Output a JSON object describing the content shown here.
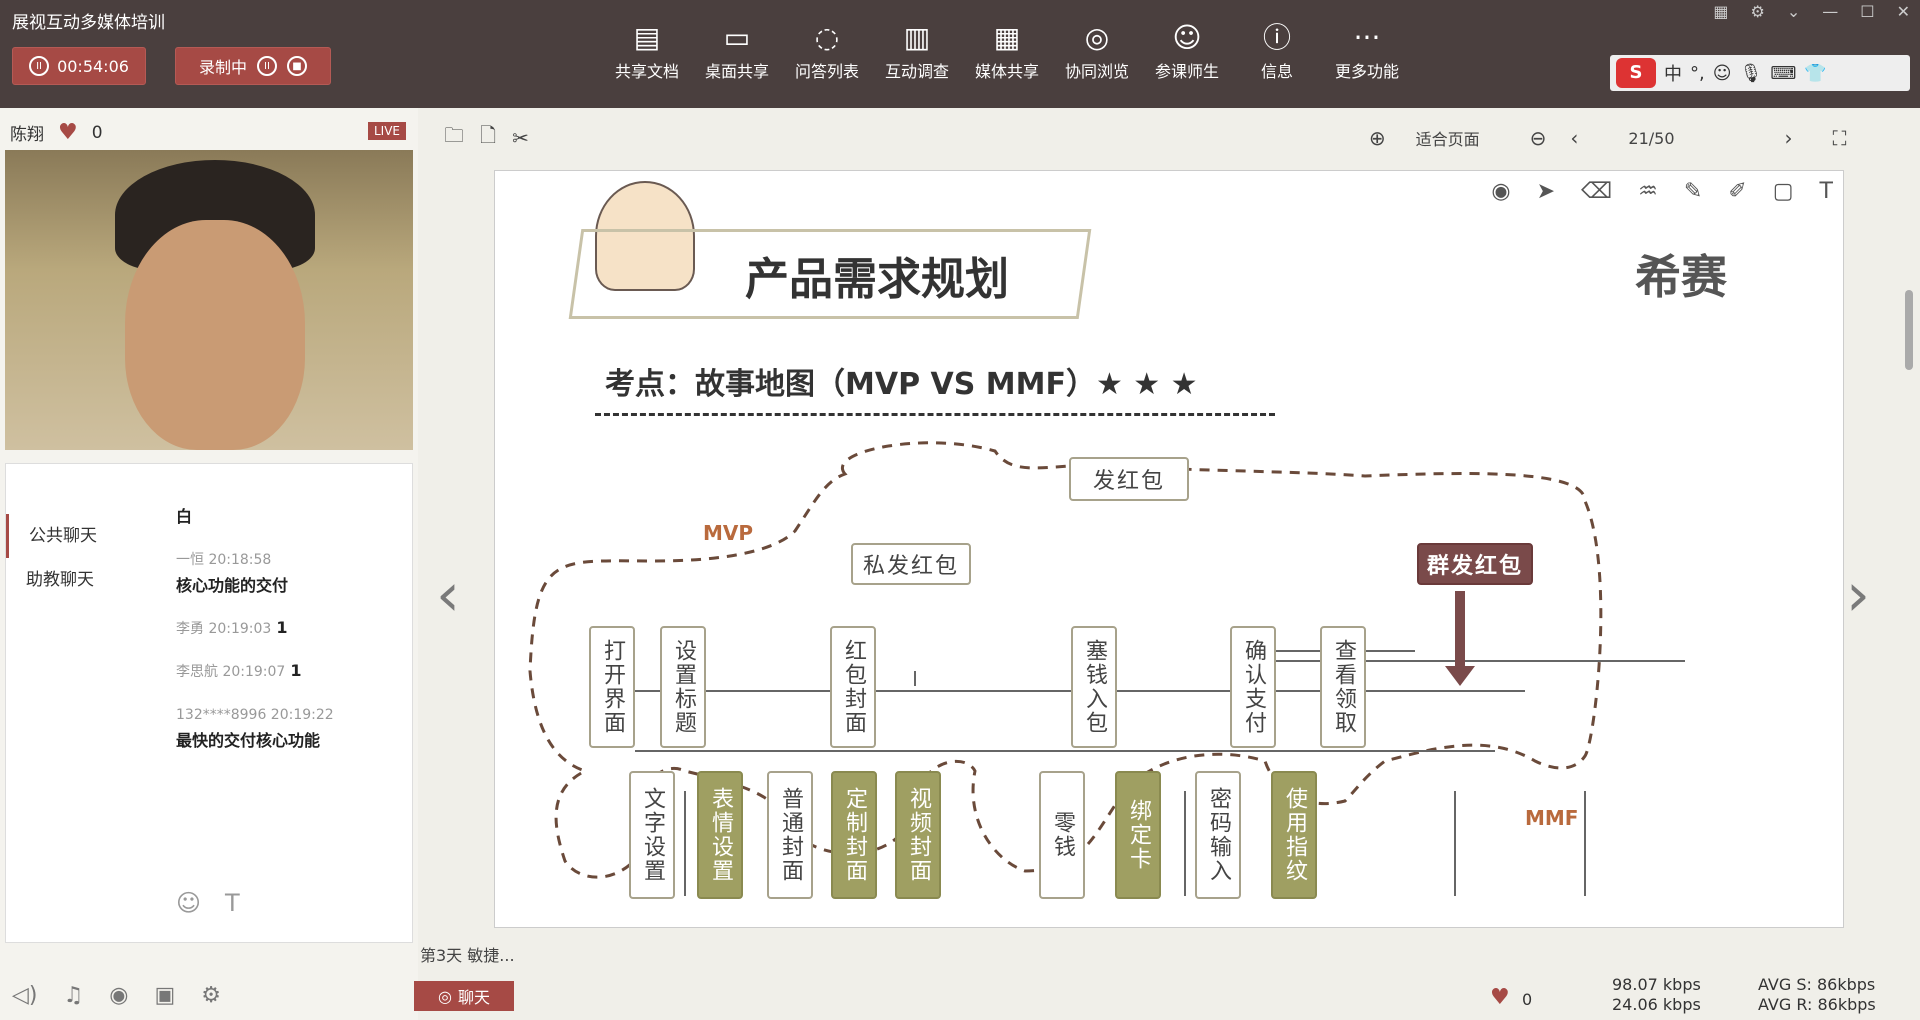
{
  "app": {
    "title": "展视互动多媒体培训",
    "timer": "00:54:06",
    "recording": "录制中"
  },
  "toolbar": [
    {
      "label": "共享文档",
      "icon": "document-icon"
    },
    {
      "label": "桌面共享",
      "icon": "monitor-icon"
    },
    {
      "label": "问答列表",
      "icon": "chat-icon"
    },
    {
      "label": "互动调查",
      "icon": "chart-icon"
    },
    {
      "label": "媒体共享",
      "icon": "film-icon"
    },
    {
      "label": "协同浏览",
      "icon": "compass-icon"
    },
    {
      "label": "参课师生",
      "icon": "people-icon"
    },
    {
      "label": "信息",
      "icon": "info-icon"
    },
    {
      "label": "更多功能",
      "icon": "more-icon"
    }
  ],
  "ime": {
    "lang": "中"
  },
  "presenter": {
    "name": "陈翔",
    "likes": "0",
    "live": "LIVE"
  },
  "chat": {
    "tabs": [
      "公共聊天",
      "助教聊天"
    ],
    "messages": [
      {
        "who": "",
        "text": "白"
      },
      {
        "who": "一恒 20:18:58",
        "text": "核心功能的交付"
      },
      {
        "who": "李勇 20:19:03",
        "text": "1"
      },
      {
        "who": "李思航 20:19:07",
        "text": "1"
      },
      {
        "who": "132****8996 20:19:22",
        "text": "最快的交付核心功能"
      }
    ]
  },
  "viewer": {
    "fit": "适合页面",
    "page": "21/50"
  },
  "slide": {
    "heading": "产品需求规划",
    "brand": "希赛",
    "subtitle": "考点：故事地图（MVP VS MMF）★ ★ ★",
    "mvp": "MVP",
    "mmf": "MMF",
    "root": "发红包",
    "private": "私发红包",
    "group": "群发红包",
    "steps": [
      "打开界面",
      "设置标题",
      "红包封面",
      "塞钱入包",
      "确认支付",
      "查看领取"
    ],
    "subs": [
      "文字设置",
      "表情设置",
      "普通封面",
      "定制封面",
      "视频封面",
      "零钱",
      "绑定卡",
      "密码输入",
      "使用指纹"
    ]
  },
  "bottom": {
    "tab": "第3天 敏捷...",
    "chat": "聊天",
    "likes": "0",
    "up": "98.07 kbps",
    "down": "24.06 kbps",
    "avg_s": "AVG S: 86kbps",
    "avg_r": "AVG R: 86kbps"
  }
}
